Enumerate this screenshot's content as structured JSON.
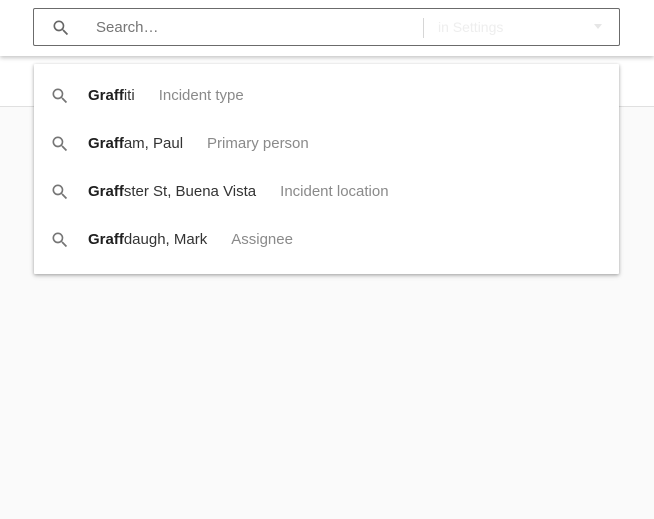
{
  "search": {
    "placeholder": "Search…",
    "value": "",
    "icon": "search-icon",
    "scope": {
      "label": "in Settings",
      "caret_icon": "caret-down-icon"
    }
  },
  "suggestions": [
    {
      "match": "Graff",
      "rest": "iti",
      "category": "Incident type"
    },
    {
      "match": "Graff",
      "rest": "am, Paul",
      "category": "Primary person"
    },
    {
      "match": "Graff",
      "rest": "ster St, Buena Vista",
      "category": "Incident location"
    },
    {
      "match": "Graff",
      "rest": "daugh, Mark",
      "category": "Assignee"
    }
  ],
  "colors": {
    "background": "#fafafa",
    "surface": "#ffffff",
    "text_primary": "#1f1f1f",
    "text_secondary": "#8a8a8a",
    "icon": "#757575"
  }
}
